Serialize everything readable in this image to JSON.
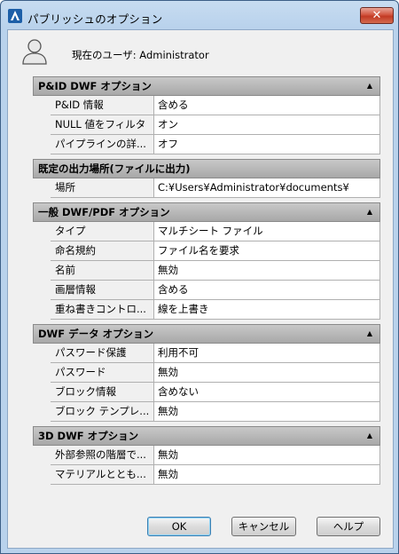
{
  "window": {
    "title": "パブリッシュのオプション",
    "close_label": "✕"
  },
  "user": {
    "label": "現在のユーザ: Administrator"
  },
  "sections": [
    {
      "title": "P&ID DWF オプション",
      "collapse": "▲",
      "rows": [
        {
          "key": "P&ID 情報",
          "value": "含める"
        },
        {
          "key": "NULL 値をフィルタ",
          "value": "オン"
        },
        {
          "key": "パイプラインの詳...",
          "value": "オフ"
        }
      ]
    },
    {
      "title": "既定の出力場所(ファイルに出力)",
      "collapse": "",
      "rows": [
        {
          "key": "場所",
          "value": "C:¥Users¥Administrator¥documents¥"
        }
      ]
    },
    {
      "title": "一般 DWF/PDF オプション",
      "collapse": "▲",
      "rows": [
        {
          "key": "タイプ",
          "value": "マルチシート ファイル"
        },
        {
          "key": "命名規約",
          "value": "ファイル名を要求"
        },
        {
          "key": "名前",
          "value": "無効"
        },
        {
          "key": "画層情報",
          "value": "含める"
        },
        {
          "key": "重ね書きコントロ...",
          "value": "線を上書き"
        }
      ]
    },
    {
      "title": "DWF データ オプション",
      "collapse": "▲",
      "rows": [
        {
          "key": "パスワード保護",
          "value": "利用不可"
        },
        {
          "key": "パスワード",
          "value": "無効"
        },
        {
          "key": "ブロック情報",
          "value": "含めない"
        },
        {
          "key": "ブロック テンプレ...",
          "value": "無効"
        }
      ]
    },
    {
      "title": "3D DWF オプション",
      "collapse": "▲",
      "rows": [
        {
          "key": "外部参照の階層で...",
          "value": "無効"
        },
        {
          "key": "マテリアルととも...",
          "value": "無効"
        }
      ]
    }
  ],
  "buttons": {
    "ok": "OK",
    "cancel": "キャンセル",
    "help": "ヘルプ"
  },
  "icons": {
    "app": "autocad-icon",
    "user": "user-icon",
    "close": "close-icon"
  }
}
